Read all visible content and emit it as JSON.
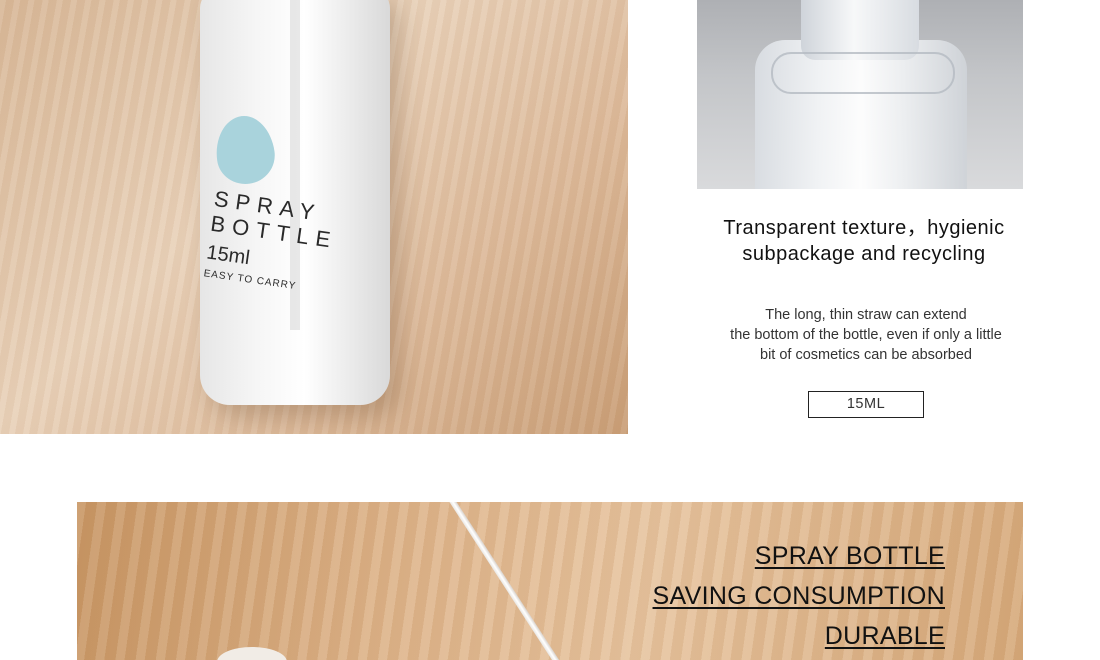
{
  "product_label": {
    "line1": "SPRAY",
    "line2": "BOTTLE",
    "size": "15ml",
    "tagline": "EASY TO CARRY"
  },
  "feature": {
    "title_line1": "Transparent texture，hygienic",
    "title_line2": "subpackage and recycling",
    "desc_line1": "The long, thin straw can extend",
    "desc_line2": "the bottom of the bottle, even if only a little",
    "desc_line3": "bit of cosmetics can be absorbed",
    "capacity_badge": "15ML"
  },
  "banner": {
    "lines": [
      "SPRAY BOTTLE",
      "SAVING CONSUMPTION",
      "DURABLE"
    ]
  }
}
